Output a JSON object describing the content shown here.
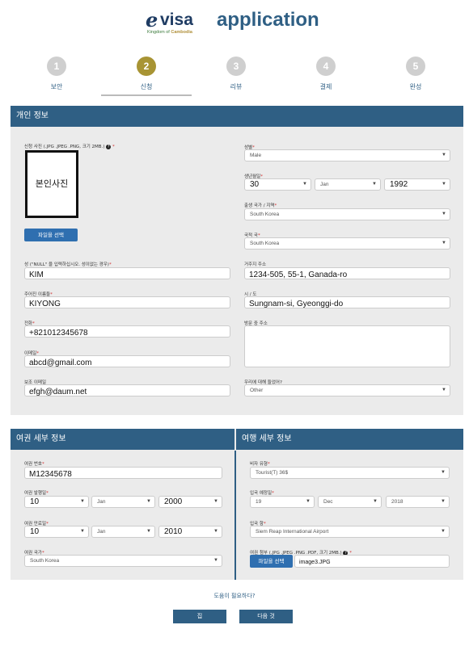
{
  "brand": {
    "logo_e": "e",
    "logo_visa": "visa",
    "logo_sub_prefix": "Kingdom of ",
    "logo_sub_bold": "Cambodia",
    "title": "application"
  },
  "steps": [
    {
      "num": "1",
      "label": "보안"
    },
    {
      "num": "2",
      "label": "신청"
    },
    {
      "num": "3",
      "label": "리뷰"
    },
    {
      "num": "4",
      "label": "결제"
    },
    {
      "num": "5",
      "label": "완성"
    }
  ],
  "personal": {
    "title": "개인 정보",
    "photo_label": "신청 사진 (.JPG .JPEG .PNG, 크기 2MB.)",
    "photo_text": "본인사진",
    "file_button": "파일을 선택",
    "surname_label": "성 (\"NULL\" 을 입력하십시오. 성이없는 경우)",
    "surname": "KIM",
    "given_label": "주어진 이름들",
    "given": "KIYONG",
    "phone_label": "전화",
    "phone": "+821012345678",
    "email_label": "이메일",
    "email": "abcd@gmail.com",
    "alt_email_label": "보조 이메일",
    "alt_email": "efgh@daum.net",
    "gender_label": "성별",
    "gender": "Male",
    "dob_label": "생년월일",
    "dob_day": "30",
    "dob_month": "Jan",
    "dob_year": "1992",
    "birth_country_label": "출생 국가 / 지역",
    "birth_country": "South Korea",
    "nationality_label": "국적 국",
    "nationality": "South Korea",
    "address_label": "거주지 주소",
    "address": "1234-505, 55-1, Ganada-ro",
    "city_label": "시 / 도",
    "city": "Sungnam-si, Gyeonggi-do",
    "visit_address_label": "방문 중 주소",
    "heard_label": "우리에 대해 들었어?",
    "heard": "Other"
  },
  "passport": {
    "title": "여권 세부 정보",
    "number_label": "여권 번호",
    "number": "M12345678",
    "issue_label": "여권 발행일",
    "issue_day": "10",
    "issue_month": "Jan",
    "issue_year": "2000",
    "expiry_label": "여권 만료일",
    "expiry_day": "10",
    "expiry_month": "Jan",
    "expiry_year": "2010",
    "country_label": "여권 국가",
    "country": "South Korea"
  },
  "travel": {
    "title": "여행 세부 정보",
    "visa_type_label": "비자 유형",
    "visa_type": "Tourist(T) 36$",
    "entry_date_label": "입국 예정일",
    "entry_day": "19",
    "entry_month": "Dec",
    "entry_year": "2018",
    "port_label": "입국 항",
    "port": "Siem Reap International Airport",
    "attach_label": "여권 첨부 (.JPG .JPEG .PNG .PDF, 크기 2MB.)",
    "attach_button": "파일을 선택",
    "attach_file": "image3.JPG"
  },
  "footer": {
    "help": "도움이 필요하다?",
    "home": "집",
    "next": "다음 것"
  },
  "colors": {
    "primary": "#2f5f84",
    "active_step": "#a89434",
    "panel_bg": "#ebebeb",
    "button_blue": "#2f6fb0"
  }
}
